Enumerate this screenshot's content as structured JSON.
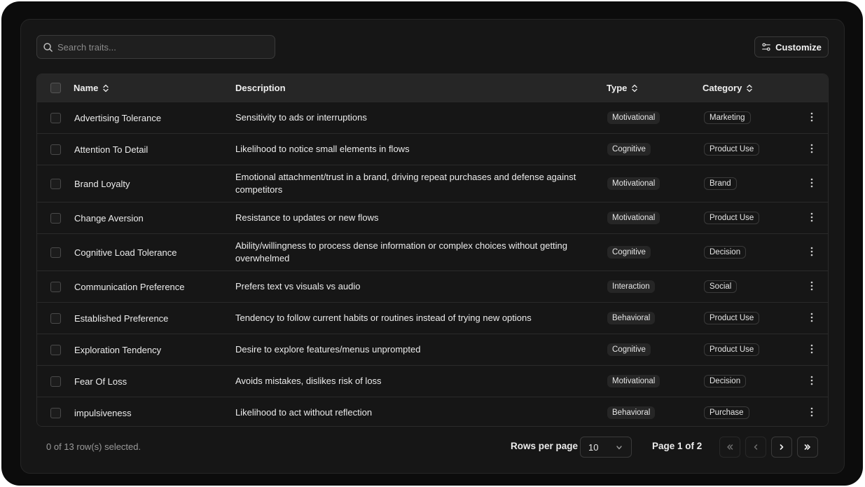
{
  "search": {
    "placeholder": "Search traits..."
  },
  "toolbar": {
    "customize_label": "Customize"
  },
  "table": {
    "headers": {
      "name": "Name",
      "description": "Description",
      "type": "Type",
      "category": "Category"
    },
    "rows": [
      {
        "name": "Advertising Tolerance",
        "description": "Sensitivity to ads or interruptions",
        "type": "Motivational",
        "category": "Marketing"
      },
      {
        "name": "Attention To Detail",
        "description": "Likelihood to notice small elements in flows",
        "type": "Cognitive",
        "category": "Product Use"
      },
      {
        "name": "Brand Loyalty",
        "description": "Emotional attachment/trust in a brand, driving repeat purchases and defense against competitors",
        "type": "Motivational",
        "category": "Brand"
      },
      {
        "name": "Change Aversion",
        "description": "Resistance to updates or new flows",
        "type": "Motivational",
        "category": "Product Use"
      },
      {
        "name": "Cognitive Load Tolerance",
        "description": "Ability/willingness to process dense information or complex choices without getting overwhelmed",
        "type": "Cognitive",
        "category": "Decision"
      },
      {
        "name": "Communication Preference",
        "description": "Prefers text vs visuals vs audio",
        "type": "Interaction",
        "category": "Social"
      },
      {
        "name": "Established Preference",
        "description": "Tendency to follow current habits or routines instead of trying new options",
        "type": "Behavioral",
        "category": "Product Use"
      },
      {
        "name": "Exploration Tendency",
        "description": "Desire to explore features/menus unprompted",
        "type": "Cognitive",
        "category": "Product Use"
      },
      {
        "name": "Fear Of Loss",
        "description": "Avoids mistakes, dislikes risk of loss",
        "type": "Motivational",
        "category": "Decision"
      },
      {
        "name": "impulsiveness",
        "description": "Likelihood to act without reflection",
        "type": "Behavioral",
        "category": "Purchase"
      }
    ]
  },
  "footer": {
    "selection": "0 of 13 row(s) selected.",
    "rows_per_page_label": "Rows per page",
    "rows_per_page_value": "10",
    "page_info": "Page 1 of 2"
  },
  "colors": {
    "background": "#0c0c0c",
    "panel": "#161616",
    "header": "#262626",
    "border": "#2a2a2a"
  }
}
